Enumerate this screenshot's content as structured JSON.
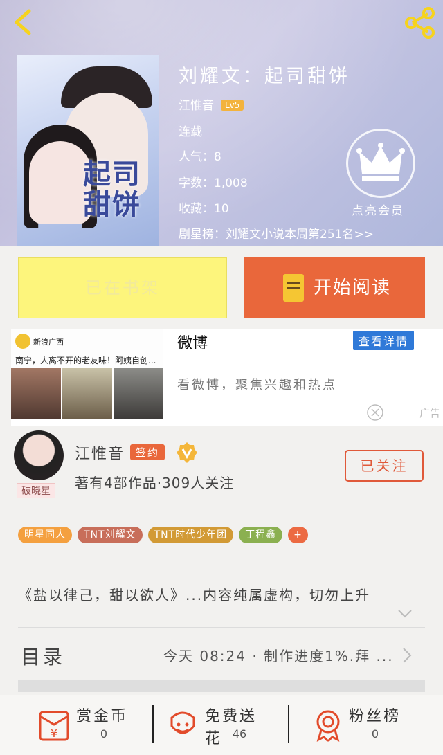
{
  "nav": {
    "back_icon": "chevron-left-icon",
    "share_icon": "share-icon"
  },
  "book": {
    "title": "刘耀文：起司甜饼",
    "cover_title": "起司甜饼",
    "author": "江惟音",
    "level": "Lv5",
    "status": "连载",
    "popularity": "人气：8",
    "word_count": "字数：1,008",
    "favorites": "收藏：10",
    "ranking": "剧星榜：刘耀文小说本周第251名>>"
  },
  "vip": {
    "label": "点亮会员",
    "icon": "crown-icon"
  },
  "actions": {
    "shelf_label": "已在书架",
    "read_label": "开始阅读"
  },
  "ad": {
    "source": "新浪广西",
    "headline": "南宁，人离不开的老友味！阿姨自创...",
    "brand": "微博",
    "details_label": "查看详情",
    "subtitle": "看微博，聚焦兴趣和热点",
    "ad_label": "广告"
  },
  "author_card": {
    "name": "江惟音",
    "signed_label": "签约",
    "avatar_badge": "破晓星",
    "stats": "著有4部作品·309人关注",
    "follow_label": "已关注"
  },
  "tags": [
    {
      "label": "明星同人",
      "color": "#f4a03f"
    },
    {
      "label": "TNT刘耀文",
      "color": "#c86e5a"
    },
    {
      "label": "TNT时代少年团",
      "color": "#d29a35"
    },
    {
      "label": "丁程鑫",
      "color": "#8bb050"
    },
    {
      "label": "+",
      "color": "#ec6a42"
    }
  ],
  "intro": {
    "text": "《盐以律己，甜以欲人》...内容纯属虚构，切勿上升"
  },
  "toc": {
    "label": "目录",
    "update": "今天 08:24 · 制作进度1%.拜 ..."
  },
  "bottom_bar": [
    {
      "label": "赏金币",
      "count": "0",
      "icon": "red-envelope-icon"
    },
    {
      "label": "免费送花",
      "count": "46",
      "icon": "flower-icon"
    },
    {
      "label": "粉丝榜",
      "count": "0",
      "icon": "medal-icon"
    }
  ],
  "colors": {
    "accent": "#e9673b",
    "shelf_yellow": "#fdf57c",
    "weibo_blue": "#2f79d8"
  }
}
